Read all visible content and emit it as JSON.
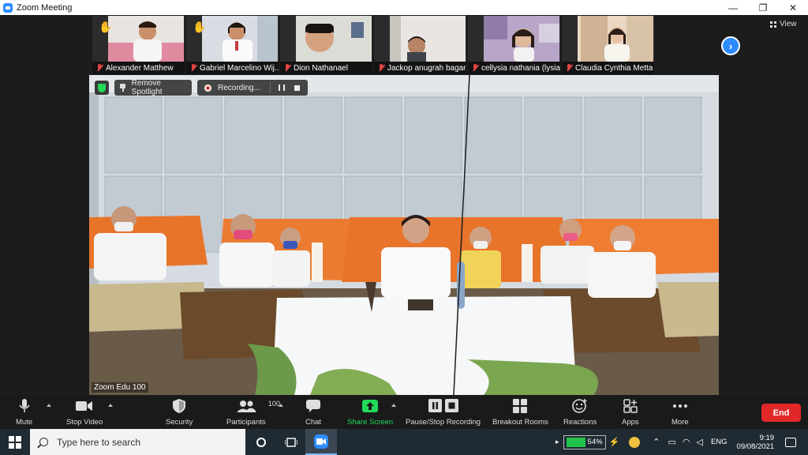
{
  "window": {
    "title": "Zoom Meeting",
    "controls": [
      "—",
      "❐",
      "✕"
    ]
  },
  "participants_strip": [
    {
      "name": "Alexander Matthew",
      "hand_raised": true,
      "muted": true
    },
    {
      "name": "Gabriel Marcelino Wij...",
      "hand_raised": true,
      "muted": true
    },
    {
      "name": "Dion Nathanael",
      "hand_raised": false,
      "muted": true
    },
    {
      "name": "Jackop anugrah bagar...",
      "hand_raised": false,
      "muted": true
    },
    {
      "name": "cellysia nathania (lysia)",
      "hand_raised": false,
      "muted": true
    },
    {
      "name": "Claudia Cynthia Metta",
      "hand_raised": false,
      "muted": true
    }
  ],
  "view_button": {
    "label": "View"
  },
  "spotlight": {
    "remove_label": "Remove Spotlight",
    "recording_label": "Recording...",
    "speaker_name": "Zoom Edu 100"
  },
  "toolbar": {
    "mute": "Mute",
    "stop_video": "Stop Video",
    "security": "Security",
    "participants": "Participants",
    "participants_count": "100",
    "chat": "Chat",
    "share_screen": "Share Screen",
    "pause_stop_recording": "Pause/Stop Recording",
    "breakout_rooms": "Breakout Rooms",
    "reactions": "Reactions",
    "apps": "Apps",
    "more": "More",
    "end": "End"
  },
  "taskbar": {
    "search_placeholder": "Type here to search",
    "battery": "54%",
    "language": "ENG",
    "time": "9:19",
    "date": "09/08/2021"
  },
  "colors": {
    "zoom_blue": "#2d8cff",
    "share_green": "#23d959",
    "end_red": "#e02828",
    "toolbar_bg": "#1a1a1a",
    "taskbar_bg": "#1f2a33"
  }
}
